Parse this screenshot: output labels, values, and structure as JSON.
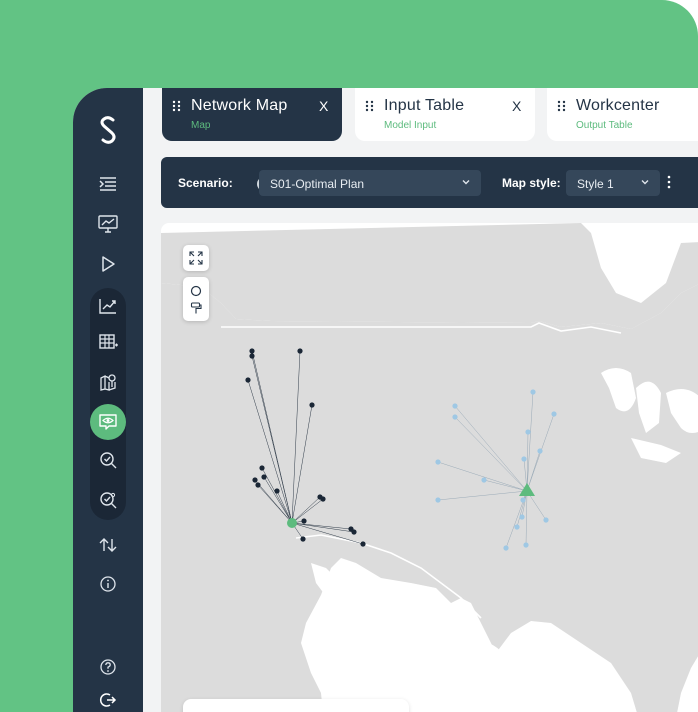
{
  "app": {
    "logo_icon": "s-logo-icon",
    "colors": {
      "brand_green": "#62c384",
      "navy": "#243446",
      "accent": "#5dbb7e",
      "demand_dot": "#9fc8e4",
      "customer_dot": "#1b2736"
    }
  },
  "sidebar": {
    "items": [
      {
        "icon": "menu-collapse-icon"
      },
      {
        "icon": "monitor-chart-icon"
      },
      {
        "icon": "play-icon"
      },
      {
        "icon": "line-chart-icon"
      },
      {
        "icon": "table-icon"
      },
      {
        "icon": "map-pin-icon"
      },
      {
        "icon": "eye-chat-icon",
        "active": true
      },
      {
        "icon": "search-check-icon"
      },
      {
        "icon": "search-gear-icon"
      },
      {
        "icon": "sort-arrows-icon"
      },
      {
        "icon": "info-icon"
      },
      {
        "icon": "help-icon"
      },
      {
        "icon": "logout-icon"
      }
    ]
  },
  "tabs": [
    {
      "title": "Network Map",
      "subtitle": "Map",
      "close": "X",
      "active": true
    },
    {
      "title": "Input Table",
      "subtitle": "Model Input",
      "close": "X",
      "active": false
    },
    {
      "title": "Workcenter",
      "subtitle": "Output Table",
      "active": false
    }
  ],
  "toolbar": {
    "scenario_label": "Scenario:",
    "help_badge": "?",
    "scenario_value": "S01-Optimal Plan",
    "map_style_label": "Map style:",
    "map_style_value": "Style 1",
    "more_icon": "kebab-icon"
  },
  "map": {
    "controls": [
      "fullscreen-icon",
      "circle-select-icon",
      "paint-roller-icon"
    ]
  }
}
